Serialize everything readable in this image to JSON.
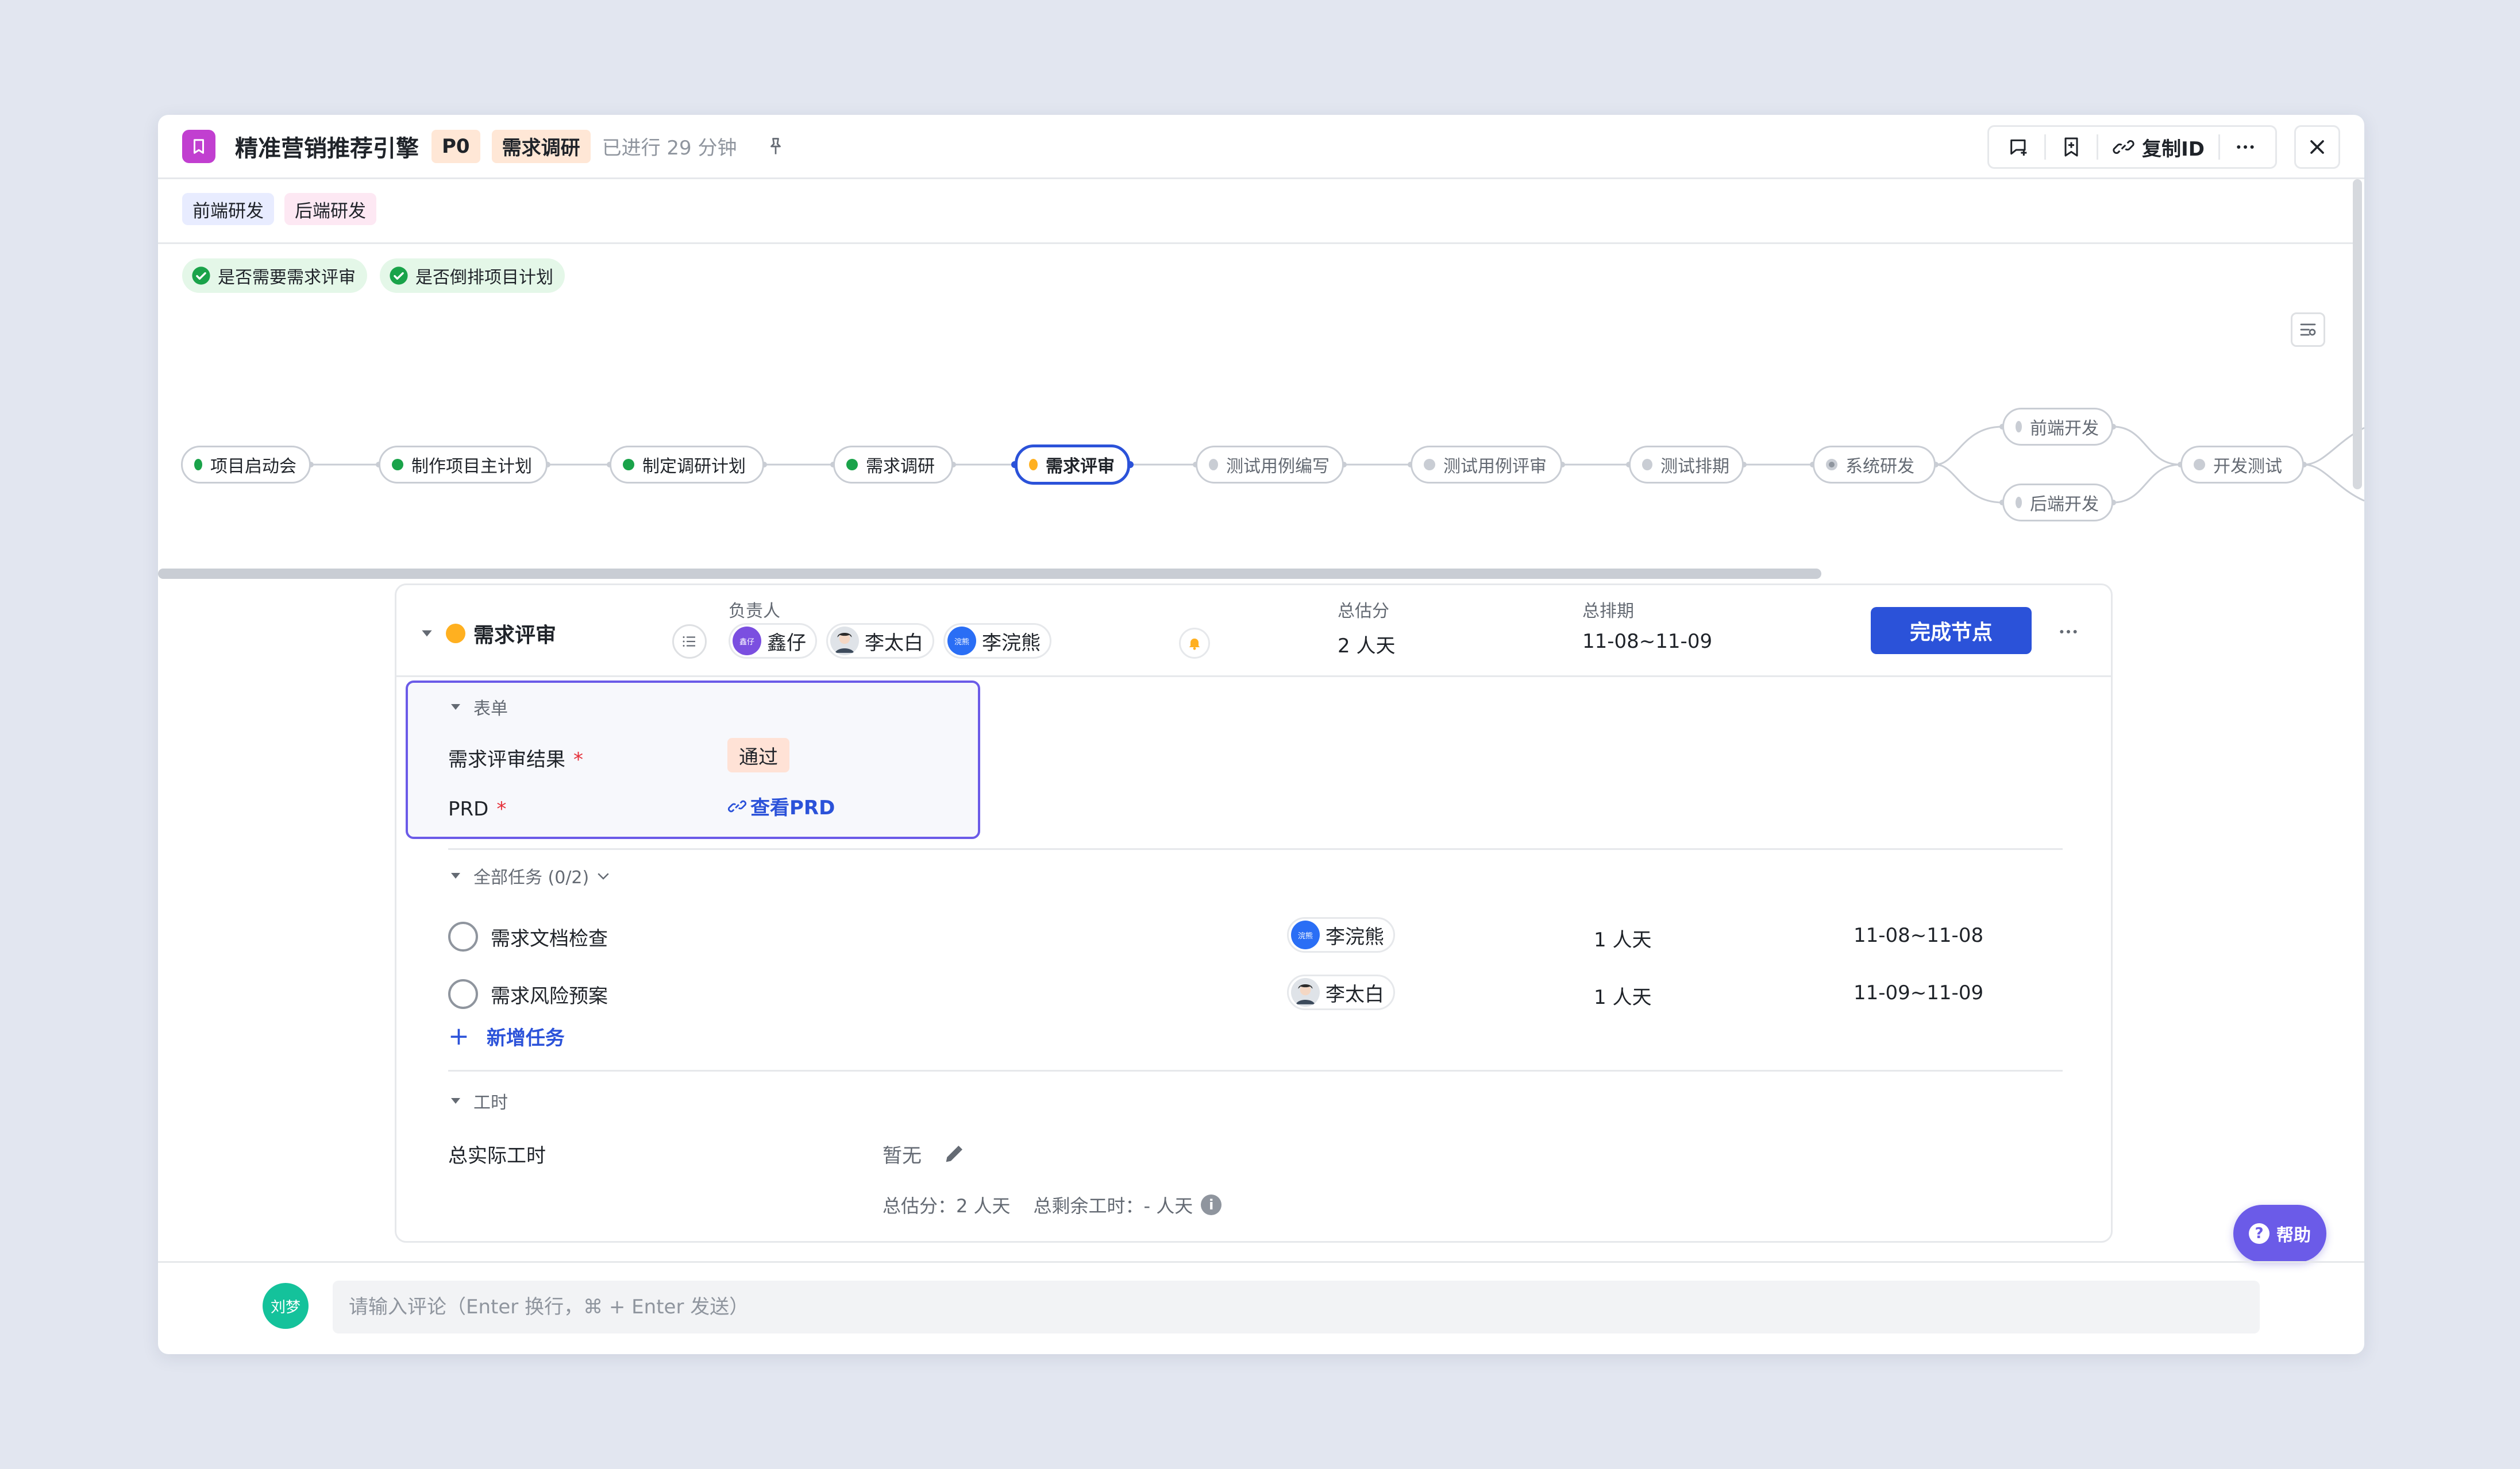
{
  "header": {
    "title": "精准营销推荐引擎",
    "priority": "P0",
    "stage": "需求调研",
    "elapsed": "已进行 29 分钟",
    "copy_id_label": "复制ID"
  },
  "teams": [
    "前端研发",
    "后端研发"
  ],
  "conditions": [
    "是否需要需求评审",
    "是否倒排项目计划"
  ],
  "flow": {
    "nodes": [
      {
        "label": "项目启动会",
        "status": "done"
      },
      {
        "label": "制作项目主计划",
        "status": "done"
      },
      {
        "label": "制定调研计划",
        "status": "done"
      },
      {
        "label": "需求调研",
        "status": "done"
      },
      {
        "label": "需求评审",
        "status": "active"
      },
      {
        "label": "测试用例编写",
        "status": "todo"
      },
      {
        "label": "测试用例评审",
        "status": "todo"
      },
      {
        "label": "测试排期",
        "status": "todo"
      },
      {
        "label": "系统研发",
        "status": "progress"
      },
      {
        "label": "前端开发",
        "status": "todo"
      },
      {
        "label": "后端开发",
        "status": "todo"
      },
      {
        "label": "开发测试",
        "status": "todo"
      }
    ]
  },
  "node_card": {
    "name": "需求评审",
    "owner_label": "负责人",
    "owners": [
      {
        "name": "鑫仔",
        "avatar_text": "鑫仔",
        "avatar_color": "#7b4fe0"
      },
      {
        "name": "李太白",
        "avatar_text": "",
        "avatar_color": "#e9ecef"
      },
      {
        "name": "李浣熊",
        "avatar_text": "浣熊",
        "avatar_color": "#2a6ef5"
      }
    ],
    "estimate_label": "总估分",
    "estimate_value": "2 人天",
    "schedule_label": "总排期",
    "schedule_value": "11-08~11-09",
    "complete_button": "完成节点"
  },
  "form": {
    "section_title": "表单",
    "fields": [
      {
        "label": "需求评审结果",
        "value": "通过"
      },
      {
        "label": "PRD",
        "value": "查看PRD"
      }
    ]
  },
  "tasks": {
    "section_title": "全部任务 (0/2)",
    "items": [
      {
        "name": "需求文档检查",
        "owner": "李浣熊",
        "owner_avatar_text": "浣熊",
        "estimate": "1 人天",
        "date": "11-08~11-08"
      },
      {
        "name": "需求风险预案",
        "owner": "李太白",
        "owner_avatar_text": "",
        "estimate": "1 人天",
        "date": "11-09~11-09"
      }
    ],
    "add_label": "新增任务"
  },
  "worktime": {
    "section_title": "工时",
    "actual_label": "总实际工时",
    "actual_value": "暂无",
    "estimate_summary": "总估分：2 人天",
    "remaining_summary": "总剩余工时：- 人天"
  },
  "help_label": "帮助",
  "comment": {
    "user_avatar_text": "刘梦",
    "placeholder": "请输入评论（Enter 换行，⌘ + Enter 发送）"
  },
  "colors": {
    "primary": "#2b52d9",
    "done_green": "#1aa34a",
    "active_yellow": "#ffb020",
    "app_icon": "#c13fd0",
    "help_purple": "#6b5be8"
  }
}
